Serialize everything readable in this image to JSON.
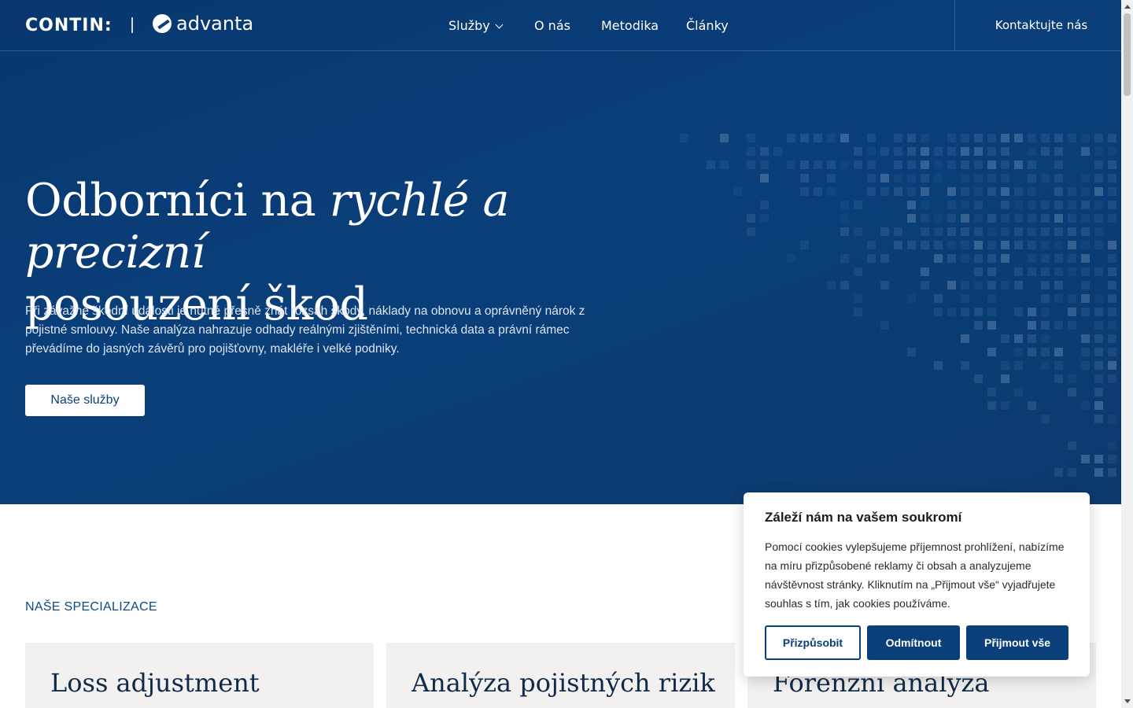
{
  "header": {
    "logo_contin": "CONTIN:",
    "logo_advanta": "advanta",
    "nav": [
      "Služby",
      "O nás",
      "Metodika",
      "Články"
    ],
    "cta": "Kontaktujte nás"
  },
  "hero": {
    "title_part1": "Odborníci na ",
    "title_italic": "rychlé a precizní",
    "title_part2": "posouzení škod",
    "text": "Při závažné škodní události je nutné přesně znát rozsah škody, náklady na obnovu a oprávněný nárok z pojistné smlouvy. Naše analýza nahrazuje odhady reálnými zjištěními, technická data a právní rámec převádíme do jasných závěrů pro pojišťovny, makléře i velké podniky.",
    "button": "Naše služby"
  },
  "section": {
    "label": "NAŠE SPECIALIZACE",
    "cards": [
      "Loss adjustment",
      "Analýza pojistných rizik",
      "Forenzní analýza"
    ]
  },
  "cookie": {
    "title": "Záleží nám na vašem soukromí",
    "text": "Pomocí cookies vylepšujeme příjemnost prohlížení, nabízíme na míru přizpůsobené reklamy či obsah a analyzujeme návštěvnost stránky. Kliknutím na „Přijmout vše“ vyjadřujete souhlas s tím, jak cookies používáme.",
    "customize": "Přizpůsobit",
    "reject": "Odmítnout",
    "accept": "Přijmout vše"
  },
  "colors": {
    "brand_dark": "#08376e",
    "brand": "#0a3f7a",
    "card_bg": "#f2f1ef"
  }
}
